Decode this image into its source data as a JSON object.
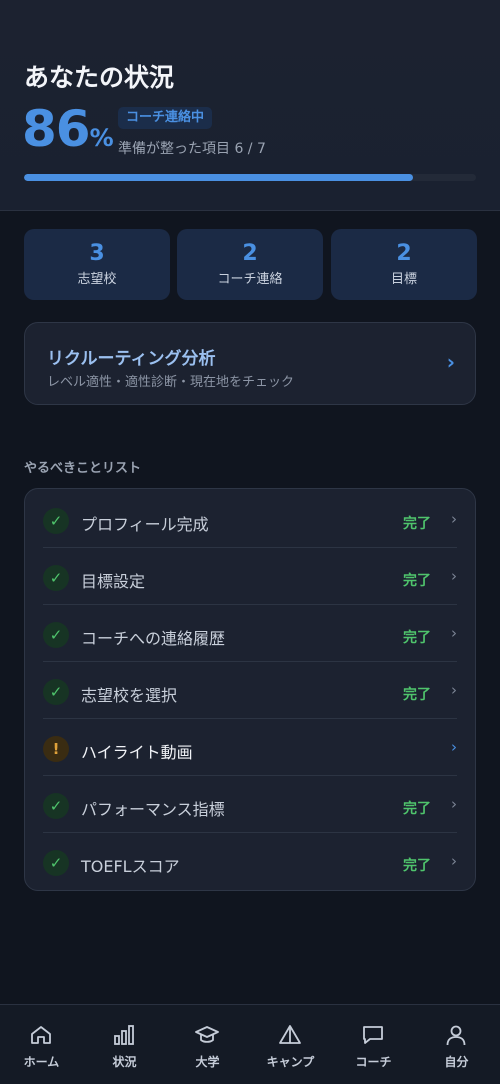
{
  "status": {
    "title": "あなたの状況",
    "percent": "86",
    "percent_unit": "%",
    "progress_fraction": 0.86,
    "badge": "コーチ連絡中",
    "ready_text": "準備が整った項目 6 / 7"
  },
  "stats": [
    {
      "value": "3",
      "label": "志望校"
    },
    {
      "value": "2",
      "label": "コーチ連絡"
    },
    {
      "value": "2",
      "label": "目標"
    }
  ],
  "analysis": {
    "title": "リクルーティング分析",
    "subtitle": "レベル適性・適性診断・現在地をチェック",
    "chevron": "›"
  },
  "todo": {
    "section_label": "やるべきことリスト",
    "items": [
      {
        "label": "プロフィール完成",
        "status": "完了",
        "icon": "check-icon",
        "mark": "✓"
      },
      {
        "label": "目標設定",
        "status": "完了",
        "icon": "check-icon",
        "mark": "✓"
      },
      {
        "label": "コーチへの連絡履歴",
        "status": "完了",
        "icon": "check-icon",
        "mark": "✓"
      },
      {
        "label": "志望校を選択",
        "status": "完了",
        "icon": "check-icon",
        "mark": "✓"
      },
      {
        "label": "ハイライト動画",
        "status": "",
        "icon": "warning-icon",
        "mark": "!"
      },
      {
        "label": "パフォーマンス指標",
        "status": "完了",
        "icon": "check-icon",
        "mark": "✓"
      },
      {
        "label": "TOEFLスコア",
        "status": "完了",
        "icon": "check-icon",
        "mark": "✓"
      }
    ],
    "chevron": "›"
  },
  "tabs": [
    {
      "label": "ホーム",
      "icon": "home-icon"
    },
    {
      "label": "状況",
      "icon": "bar-chart-icon"
    },
    {
      "label": "大学",
      "icon": "graduation-cap-icon"
    },
    {
      "label": "キャンプ",
      "icon": "tent-icon"
    },
    {
      "label": "コーチ",
      "icon": "chat-bubble-icon"
    },
    {
      "label": "自分",
      "icon": "user-icon"
    }
  ],
  "colors": {
    "accent": "#4a90e2",
    "success": "#4fc46c",
    "warning": "#e0a23a",
    "background": "#10151f"
  }
}
